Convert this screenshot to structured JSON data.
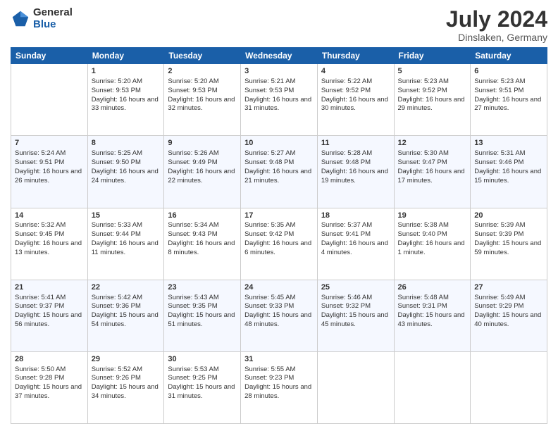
{
  "header": {
    "logo_general": "General",
    "logo_blue": "Blue",
    "month_year": "July 2024",
    "location": "Dinslaken, Germany"
  },
  "days_of_week": [
    "Sunday",
    "Monday",
    "Tuesday",
    "Wednesday",
    "Thursday",
    "Friday",
    "Saturday"
  ],
  "weeks": [
    [
      {
        "day": "",
        "sunrise": "",
        "sunset": "",
        "daylight": ""
      },
      {
        "day": "1",
        "sunrise": "Sunrise: 5:20 AM",
        "sunset": "Sunset: 9:53 PM",
        "daylight": "Daylight: 16 hours and 33 minutes."
      },
      {
        "day": "2",
        "sunrise": "Sunrise: 5:20 AM",
        "sunset": "Sunset: 9:53 PM",
        "daylight": "Daylight: 16 hours and 32 minutes."
      },
      {
        "day": "3",
        "sunrise": "Sunrise: 5:21 AM",
        "sunset": "Sunset: 9:53 PM",
        "daylight": "Daylight: 16 hours and 31 minutes."
      },
      {
        "day": "4",
        "sunrise": "Sunrise: 5:22 AM",
        "sunset": "Sunset: 9:52 PM",
        "daylight": "Daylight: 16 hours and 30 minutes."
      },
      {
        "day": "5",
        "sunrise": "Sunrise: 5:23 AM",
        "sunset": "Sunset: 9:52 PM",
        "daylight": "Daylight: 16 hours and 29 minutes."
      },
      {
        "day": "6",
        "sunrise": "Sunrise: 5:23 AM",
        "sunset": "Sunset: 9:51 PM",
        "daylight": "Daylight: 16 hours and 27 minutes."
      }
    ],
    [
      {
        "day": "7",
        "sunrise": "Sunrise: 5:24 AM",
        "sunset": "Sunset: 9:51 PM",
        "daylight": "Daylight: 16 hours and 26 minutes."
      },
      {
        "day": "8",
        "sunrise": "Sunrise: 5:25 AM",
        "sunset": "Sunset: 9:50 PM",
        "daylight": "Daylight: 16 hours and 24 minutes."
      },
      {
        "day": "9",
        "sunrise": "Sunrise: 5:26 AM",
        "sunset": "Sunset: 9:49 PM",
        "daylight": "Daylight: 16 hours and 22 minutes."
      },
      {
        "day": "10",
        "sunrise": "Sunrise: 5:27 AM",
        "sunset": "Sunset: 9:48 PM",
        "daylight": "Daylight: 16 hours and 21 minutes."
      },
      {
        "day": "11",
        "sunrise": "Sunrise: 5:28 AM",
        "sunset": "Sunset: 9:48 PM",
        "daylight": "Daylight: 16 hours and 19 minutes."
      },
      {
        "day": "12",
        "sunrise": "Sunrise: 5:30 AM",
        "sunset": "Sunset: 9:47 PM",
        "daylight": "Daylight: 16 hours and 17 minutes."
      },
      {
        "day": "13",
        "sunrise": "Sunrise: 5:31 AM",
        "sunset": "Sunset: 9:46 PM",
        "daylight": "Daylight: 16 hours and 15 minutes."
      }
    ],
    [
      {
        "day": "14",
        "sunrise": "Sunrise: 5:32 AM",
        "sunset": "Sunset: 9:45 PM",
        "daylight": "Daylight: 16 hours and 13 minutes."
      },
      {
        "day": "15",
        "sunrise": "Sunrise: 5:33 AM",
        "sunset": "Sunset: 9:44 PM",
        "daylight": "Daylight: 16 hours and 11 minutes."
      },
      {
        "day": "16",
        "sunrise": "Sunrise: 5:34 AM",
        "sunset": "Sunset: 9:43 PM",
        "daylight": "Daylight: 16 hours and 8 minutes."
      },
      {
        "day": "17",
        "sunrise": "Sunrise: 5:35 AM",
        "sunset": "Sunset: 9:42 PM",
        "daylight": "Daylight: 16 hours and 6 minutes."
      },
      {
        "day": "18",
        "sunrise": "Sunrise: 5:37 AM",
        "sunset": "Sunset: 9:41 PM",
        "daylight": "Daylight: 16 hours and 4 minutes."
      },
      {
        "day": "19",
        "sunrise": "Sunrise: 5:38 AM",
        "sunset": "Sunset: 9:40 PM",
        "daylight": "Daylight: 16 hours and 1 minute."
      },
      {
        "day": "20",
        "sunrise": "Sunrise: 5:39 AM",
        "sunset": "Sunset: 9:39 PM",
        "daylight": "Daylight: 15 hours and 59 minutes."
      }
    ],
    [
      {
        "day": "21",
        "sunrise": "Sunrise: 5:41 AM",
        "sunset": "Sunset: 9:37 PM",
        "daylight": "Daylight: 15 hours and 56 minutes."
      },
      {
        "day": "22",
        "sunrise": "Sunrise: 5:42 AM",
        "sunset": "Sunset: 9:36 PM",
        "daylight": "Daylight: 15 hours and 54 minutes."
      },
      {
        "day": "23",
        "sunrise": "Sunrise: 5:43 AM",
        "sunset": "Sunset: 9:35 PM",
        "daylight": "Daylight: 15 hours and 51 minutes."
      },
      {
        "day": "24",
        "sunrise": "Sunrise: 5:45 AM",
        "sunset": "Sunset: 9:33 PM",
        "daylight": "Daylight: 15 hours and 48 minutes."
      },
      {
        "day": "25",
        "sunrise": "Sunrise: 5:46 AM",
        "sunset": "Sunset: 9:32 PM",
        "daylight": "Daylight: 15 hours and 45 minutes."
      },
      {
        "day": "26",
        "sunrise": "Sunrise: 5:48 AM",
        "sunset": "Sunset: 9:31 PM",
        "daylight": "Daylight: 15 hours and 43 minutes."
      },
      {
        "day": "27",
        "sunrise": "Sunrise: 5:49 AM",
        "sunset": "Sunset: 9:29 PM",
        "daylight": "Daylight: 15 hours and 40 minutes."
      }
    ],
    [
      {
        "day": "28",
        "sunrise": "Sunrise: 5:50 AM",
        "sunset": "Sunset: 9:28 PM",
        "daylight": "Daylight: 15 hours and 37 minutes."
      },
      {
        "day": "29",
        "sunrise": "Sunrise: 5:52 AM",
        "sunset": "Sunset: 9:26 PM",
        "daylight": "Daylight: 15 hours and 34 minutes."
      },
      {
        "day": "30",
        "sunrise": "Sunrise: 5:53 AM",
        "sunset": "Sunset: 9:25 PM",
        "daylight": "Daylight: 15 hours and 31 minutes."
      },
      {
        "day": "31",
        "sunrise": "Sunrise: 5:55 AM",
        "sunset": "Sunset: 9:23 PM",
        "daylight": "Daylight: 15 hours and 28 minutes."
      },
      {
        "day": "",
        "sunrise": "",
        "sunset": "",
        "daylight": ""
      },
      {
        "day": "",
        "sunrise": "",
        "sunset": "",
        "daylight": ""
      },
      {
        "day": "",
        "sunrise": "",
        "sunset": "",
        "daylight": ""
      }
    ]
  ]
}
